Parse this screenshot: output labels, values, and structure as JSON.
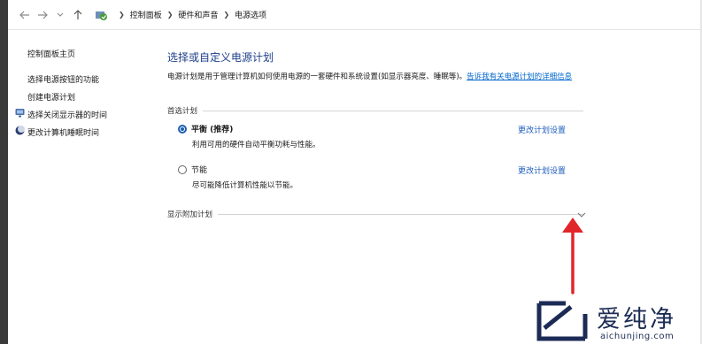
{
  "addressbar": {
    "breadcrumbs": [
      "控制面板",
      "硬件和声音",
      "电源选项"
    ]
  },
  "sidebar": {
    "home": "控制面板主页",
    "items": [
      {
        "label": "选择电源按钮的功能",
        "icon": ""
      },
      {
        "label": "创建电源计划",
        "icon": ""
      },
      {
        "label": "选择关闭显示器的时间",
        "icon": "monitor-icon"
      },
      {
        "label": "更改计算机睡眠时间",
        "icon": "moon-icon"
      }
    ]
  },
  "main": {
    "title": "选择或自定义电源计划",
    "description": "电源计划是用于管理计算机如何使用电源的一套硬件和系统设置(如显示器亮度、睡眠等)。",
    "description_link": "告诉我有关电源计划的详细信息",
    "preferred_section": "首选计划",
    "plans": [
      {
        "name": "平衡 (推荐)",
        "desc": "利用可用的硬件自动平衡功耗与性能。",
        "selected": true,
        "change_label": "更改计划设置"
      },
      {
        "name": "节能",
        "desc": "尽可能降低计算机性能以节能。",
        "selected": false,
        "change_label": "更改计划设置"
      }
    ],
    "additional_section": "显示附加计划"
  },
  "watermark": {
    "text": "爱纯净",
    "url": "aichunjing.com"
  },
  "colors": {
    "title_blue": "#1e3f8a",
    "link_blue": "#1e5dbd",
    "arrow_red": "#e0262b"
  }
}
